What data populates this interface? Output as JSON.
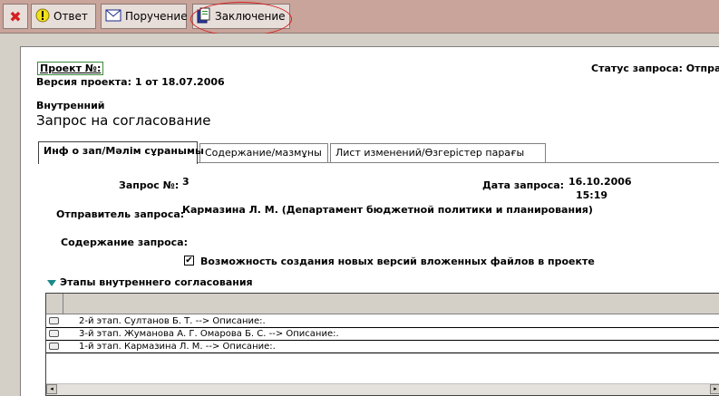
{
  "toolbar": {
    "close_label": "✖",
    "answer_label": "Ответ",
    "task_label": "Поручение",
    "conclusion_label": "Заключение",
    "icons": [
      "close-icon",
      "exclamation-icon",
      "envelope-icon",
      "document-icon"
    ],
    "accent_close": "#d42020",
    "highlight_oval": "#d42020"
  },
  "header": {
    "project_no": "Проект №:",
    "version": "Версия проекта: 1 от 18.07.2006",
    "status": "Статус запроса: Отправл"
  },
  "request": {
    "kind": "Внутренний",
    "title": "Запрос на согласование"
  },
  "tabs": [
    {
      "label": "Инф о зап/Мәлім сұранымы",
      "active": true
    },
    {
      "label": "Содержание/мазмұны",
      "active": false
    },
    {
      "label": "Лист изменений/Өзгерістер парағы",
      "active": false
    }
  ],
  "fields": {
    "request_no_label": "Запрос №:",
    "request_no_value": "3",
    "date_label": "Дата запроса:",
    "date_value": "16.10.2006",
    "time_value": "15:19",
    "sender_label": "Отправитель запроса:",
    "sender_value": "Кармазина Л. М. (Департамент бюджетной политики и планирования)",
    "content_label": "Содержание запроса:",
    "checkbox_label": "Возможность создания новых версий вложенных файлов в проекте",
    "checkbox_checked": "✔"
  },
  "stages": {
    "title": "Этапы внутреннего согласования",
    "rows": [
      "2-й этап. Султанов Б. Т. --> Описание:.",
      "3-й этап. Жуманова А. Г. Омарова Б. С. --> Описание:.",
      "1-й этап. Кармазина Л. М. --> Описание:."
    ]
  },
  "scroll": {
    "left_arrow": "◂",
    "right_arrow": "▸"
  }
}
